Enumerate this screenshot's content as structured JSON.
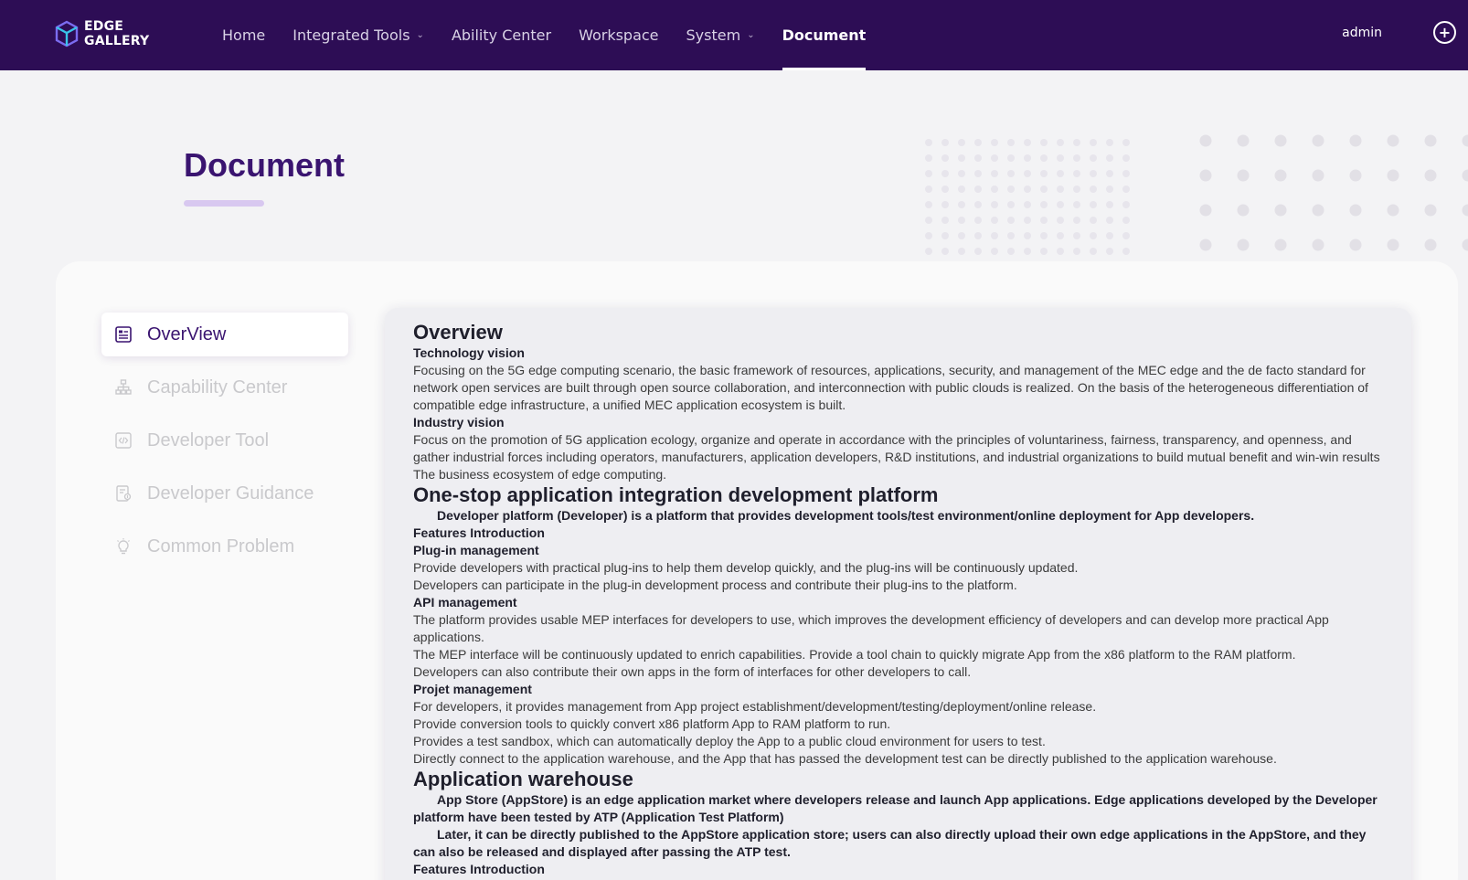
{
  "header": {
    "logo_line1": "EDGE",
    "logo_line2": "GALLERY",
    "nav": [
      {
        "label": "Home",
        "dropdown": false,
        "active": false
      },
      {
        "label": "Integrated Tools",
        "dropdown": true,
        "active": false
      },
      {
        "label": "Ability Center",
        "dropdown": false,
        "active": false
      },
      {
        "label": "Workspace",
        "dropdown": false,
        "active": false
      },
      {
        "label": "System",
        "dropdown": true,
        "active": false
      },
      {
        "label": "Document",
        "dropdown": false,
        "active": true
      }
    ],
    "user": "admin",
    "language_icon": "globe-icon"
  },
  "page": {
    "title": "Document"
  },
  "sidebar": {
    "items": [
      {
        "label": "OverView",
        "icon": "overview-icon",
        "active": true
      },
      {
        "label": "Capability Center",
        "icon": "capability-icon",
        "active": false
      },
      {
        "label": "Developer Tool",
        "icon": "code-icon",
        "active": false
      },
      {
        "label": "Developer Guidance",
        "icon": "guidance-icon",
        "active": false
      },
      {
        "label": "Common Problem",
        "icon": "lightbulb-icon",
        "active": false
      }
    ]
  },
  "content": {
    "overview_title": "Overview",
    "tech_vision_title": "Technology vision",
    "tech_vision_text": "Focusing on the 5G edge computing scenario, the basic framework of resources, applications, security, and management of the MEC edge and the de facto standard for network open services are built through open source collaboration, and interconnection with public clouds is realized. On the basis of the heterogeneous differentiation of compatible edge infrastructure, a unified MEC application ecosystem is built.",
    "industry_vision_title": "Industry vision",
    "industry_vision_text": "Focus on the promotion of 5G application ecology, organize and operate in accordance with the principles of voluntariness, fairness, transparency, and openness, and gather industrial forces including operators, manufacturers, application developers, R&D institutions, and industrial organizations to build mutual benefit and win-win results The business ecosystem of edge computing.",
    "platform_title": "One-stop application integration development platform",
    "platform_lead": "Developer platform (Developer) is a platform that provides development tools/test environment/online deployment for App developers.",
    "features_title": "Features Introduction",
    "plugin_title": "Plug-in management",
    "plugin_line1": "Provide developers with practical plug-ins to help them develop quickly, and the plug-ins will be continuously updated.",
    "plugin_line2": "Developers can participate in the plug-in development process and contribute their plug-ins to the platform.",
    "api_title": "API management",
    "api_line1": "The platform provides usable MEP interfaces for developers to use, which improves the development efficiency of developers and can develop more practical App applications.",
    "api_line2": "The MEP interface will be continuously updated to enrich capabilities. Provide a tool chain to quickly migrate App from the x86 platform to the RAM platform.",
    "api_line3": "Developers can also contribute their own apps in the form of interfaces for other developers to call.",
    "project_title": "Projet management",
    "project_line1": "For developers, it provides management from App project establishment/development/testing/deployment/online release.",
    "project_line2": "Provide conversion tools to quickly convert x86 platform App to RAM platform to run.",
    "project_line3": "Provides a test sandbox, which can automatically deploy the App to a public cloud environment for users to test.",
    "project_line4": "Directly connect to the application warehouse, and the App that has passed the development test can be directly published to the application warehouse.",
    "warehouse_title": "Application warehouse",
    "warehouse_lead1": "App Store (AppStore) is an edge application market where developers release and launch App applications. Edge applications developed by the Developer platform have been tested by ATP (Application Test Platform)",
    "warehouse_lead2": "Later, it can be directly published to the AppStore application store; users can also directly upload their own edge applications in the AppStore, and they can also be released and displayed after passing the ATP test.",
    "features_title_2": "Features Introduction"
  }
}
